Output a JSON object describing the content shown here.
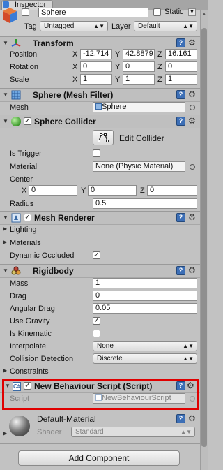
{
  "tab": {
    "title": "Inspector"
  },
  "header": {
    "object_name": "Sphere",
    "static_label": "Static",
    "tag_label": "Tag",
    "tag_value": "Untagged",
    "layer_label": "Layer",
    "layer_value": "Default"
  },
  "transform": {
    "title": "Transform",
    "position_label": "Position",
    "rotation_label": "Rotation",
    "scale_label": "Scale",
    "axis_x": "X",
    "axis_y": "Y",
    "axis_z": "Z",
    "position": {
      "x": "-12.714",
      "y": "42.8879",
      "z": "16.161"
    },
    "rotation": {
      "x": "0",
      "y": "0",
      "z": "0"
    },
    "scale": {
      "x": "1",
      "y": "1",
      "z": "1"
    }
  },
  "mesh_filter": {
    "title": "Sphere (Mesh Filter)",
    "mesh_label": "Mesh",
    "mesh_value": "Sphere"
  },
  "sphere_collider": {
    "title": "Sphere Collider",
    "edit_label": "Edit Collider",
    "is_trigger_label": "Is Trigger",
    "material_label": "Material",
    "material_value": "None (Physic Material)",
    "center_label": "Center",
    "center": {
      "x": "0",
      "y": "0",
      "z": "0"
    },
    "radius_label": "Radius",
    "radius_value": "0.5"
  },
  "mesh_renderer": {
    "title": "Mesh Renderer",
    "lighting_label": "Lighting",
    "materials_label": "Materials",
    "dynamic_occluded_label": "Dynamic Occluded"
  },
  "rigidbody": {
    "title": "Rigidbody",
    "mass_label": "Mass",
    "mass_value": "1",
    "drag_label": "Drag",
    "drag_value": "0",
    "angular_drag_label": "Angular Drag",
    "angular_drag_value": "0.05",
    "use_gravity_label": "Use Gravity",
    "is_kinematic_label": "Is Kinematic",
    "interpolate_label": "Interpolate",
    "interpolate_value": "None",
    "collision_label": "Collision Detection",
    "collision_value": "Discrete",
    "constraints_label": "Constraints"
  },
  "script": {
    "title": "New Behaviour Script (Script)",
    "script_label": "Script",
    "script_value": "NewBehaviourScript"
  },
  "material": {
    "name": "Default-Material",
    "shader_label": "Shader",
    "shader_value": "Standard"
  },
  "add_component_label": "Add Component",
  "icons": {
    "help": "help-icon",
    "gear": "gear-icon"
  },
  "colors": {
    "highlight": "#e00000",
    "help_blue": "#3d6fb6"
  }
}
